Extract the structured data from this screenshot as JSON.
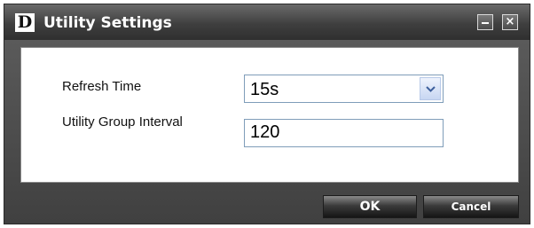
{
  "window": {
    "title": "Utility Settings",
    "logo_text": "D",
    "minimize_icon": "minimize-icon",
    "close_icon": "close-icon",
    "close_glyph": "×"
  },
  "form": {
    "refresh_time_label": "Refresh Time",
    "refresh_time_value": "15s",
    "utility_group_interval_label": "Utility Group Interval",
    "utility_group_interval_value": "120"
  },
  "buttons": {
    "ok_label": "OK",
    "cancel_label": "Cancel"
  },
  "colors": {
    "title_bar": "#3f3f3f",
    "dialog_body": "#4a4a4a",
    "content_panel": "#ffffff",
    "input_border": "#7f9db9"
  }
}
